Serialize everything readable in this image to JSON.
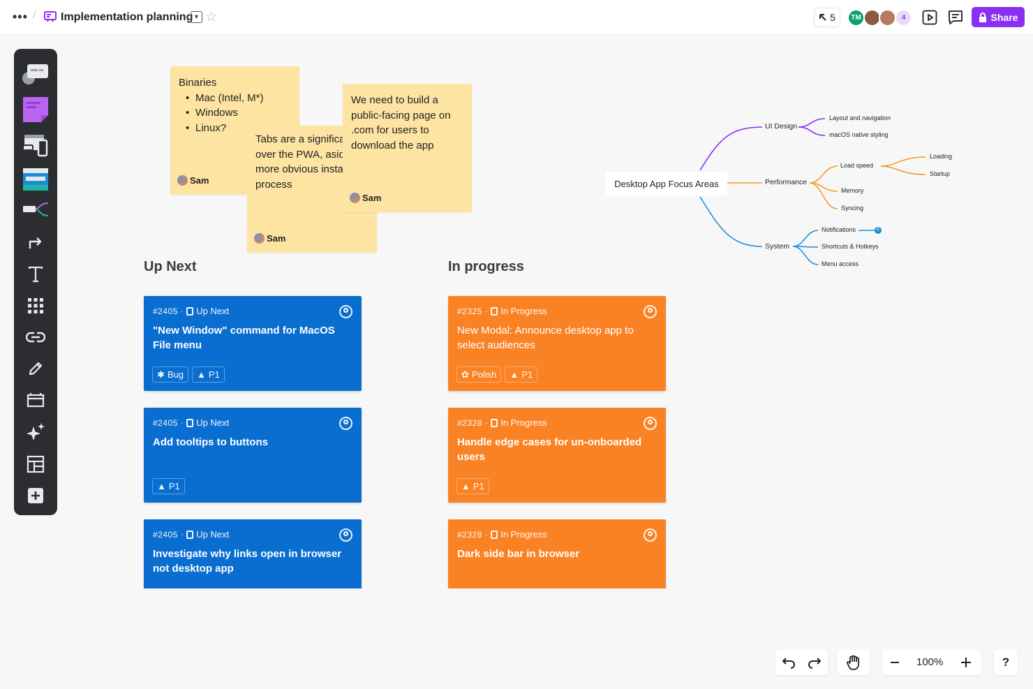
{
  "header": {
    "more_glyph": "•••",
    "separator": "/",
    "board_title": "Implementation planning",
    "cursor_count": "5",
    "avatar_initials": "TM",
    "extra_collaborators": "4",
    "share_label": "Share"
  },
  "stickies": [
    {
      "title": "Binaries",
      "items": [
        "Mac (Intel, M*)",
        "Windows",
        "Linux?"
      ],
      "author": "Sam"
    },
    {
      "text": "Tabs are a significant advantage over the PWA, aside from a more obvious installation process",
      "author": "Sam"
    },
    {
      "text": "We need to build a public-facing page on .com for users to download the app",
      "author": "Sam"
    }
  ],
  "columns": {
    "up_next": "Up Next",
    "in_progress": "In progress"
  },
  "cards": [
    {
      "id": "#2405",
      "status": "Up Next",
      "title": "\"New Window\" command for MacOS File menu",
      "tags": [
        "Bug",
        "P1"
      ]
    },
    {
      "id": "#2405",
      "status": "Up Next",
      "title": "Add tooltips to buttons",
      "tags": [
        "P1"
      ]
    },
    {
      "id": "#2405",
      "status": "Up Next",
      "title": "Investigate why links open in browser not desktop app",
      "tags": []
    },
    {
      "id": "#2325",
      "status": "In Progress",
      "title": "New Modal: Announce desktop app to select audiences",
      "tags": [
        "Polish",
        "P1"
      ]
    },
    {
      "id": "#2328",
      "status": "In Progress",
      "title": "Handle edge cases for un-onboarded users",
      "tags": [
        "P1"
      ]
    },
    {
      "id": "#2328",
      "status": "In Progress",
      "title": "Dark side bar in browser",
      "tags": []
    }
  ],
  "mindmap": {
    "root": "Desktop App Focus Areas",
    "ui_design": "UI Design",
    "layout_nav": "Layout and navigation",
    "macos_styling": "macOS native styling",
    "performance": "Performance",
    "load_speed": "Load speed",
    "loading": "Loading",
    "startup": "Startup",
    "memory": "Memory",
    "syncing": "Syncing",
    "system": "System",
    "notifications": "Notifications",
    "shortcuts": "Shortcuts & Hotkeys",
    "menu_access": "Menu access",
    "notifications_badge": "2"
  },
  "controls": {
    "zoom": "100%",
    "help": "?"
  },
  "colors": {
    "accent": "#8b2ff2",
    "card_blue": "#0a6ed1",
    "card_orange": "#f98225",
    "sticky": "#fde4a3",
    "toolbar": "#2b2d31"
  }
}
